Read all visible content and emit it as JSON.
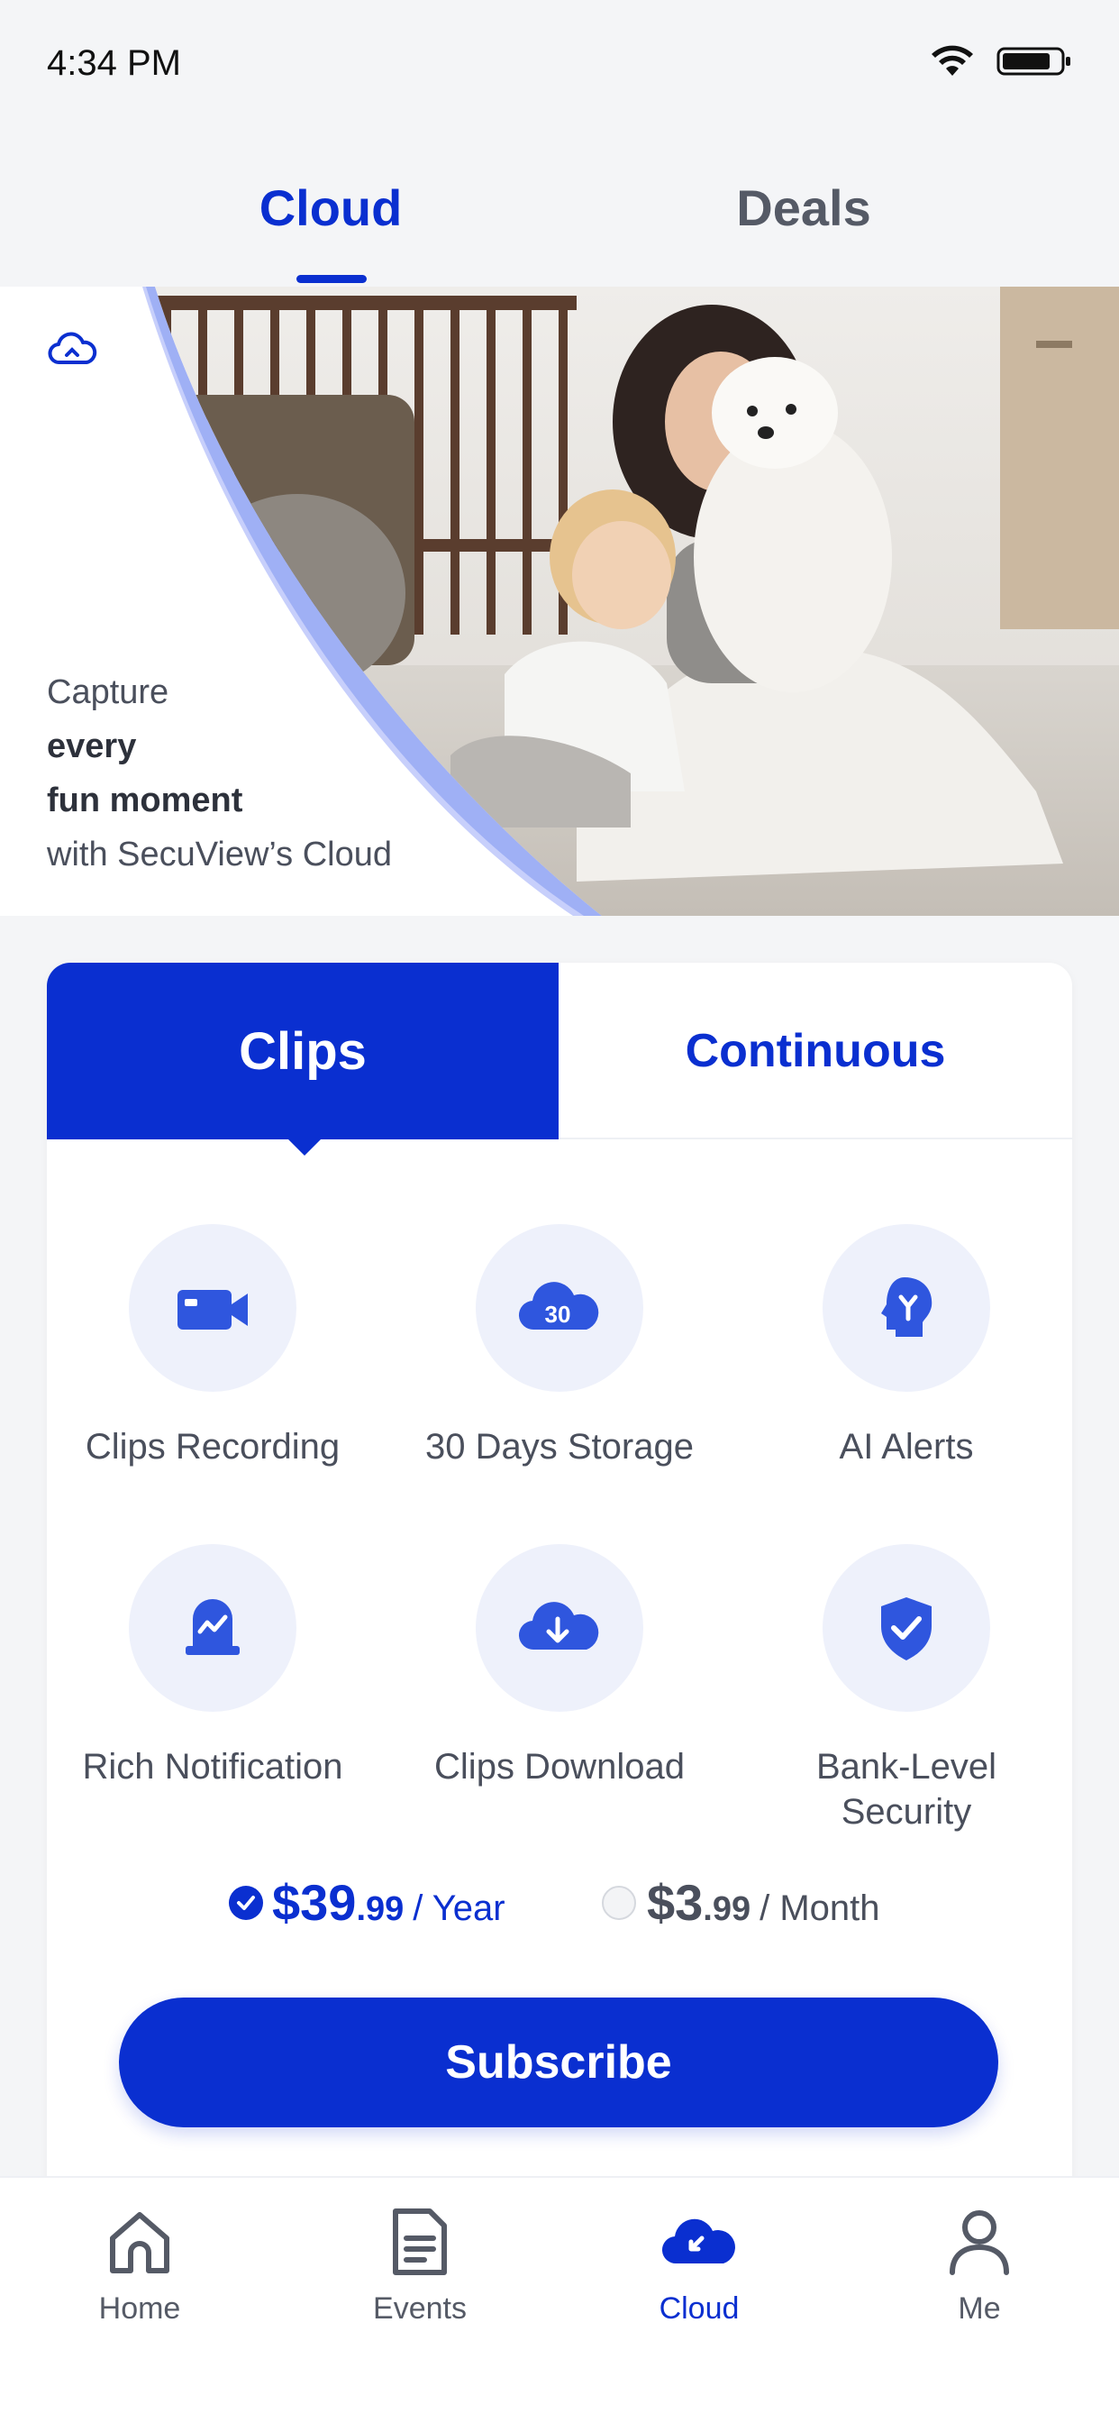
{
  "status_bar": {
    "time": "4:34 PM",
    "icons": [
      "wifi-icon",
      "battery-icon"
    ]
  },
  "top_tabs": {
    "cloud": "Cloud",
    "deals": "Deals",
    "active": "Cloud"
  },
  "banner": {
    "icon": "cloud-icon",
    "line1": "Capture",
    "line2": "every",
    "line3": "fun moment",
    "line4": "with SecuView’s Cloud"
  },
  "plan_tabs": {
    "clips": "Clips",
    "continuous": "Continuous",
    "active": "Clips"
  },
  "features": [
    {
      "label": "Clips Recording",
      "icon": "video-camera-icon"
    },
    {
      "label": "30 Days Storage",
      "icon": "cloud-30-icon",
      "badge": "30"
    },
    {
      "label": "AI Alerts",
      "icon": "ai-head-icon"
    },
    {
      "label": "Rich Notification",
      "icon": "notification-icon"
    },
    {
      "label": "Clips Download",
      "icon": "cloud-download-icon"
    },
    {
      "label": "Bank-Level Security",
      "icon": "shield-check-icon"
    }
  ],
  "pricing": {
    "year": {
      "dollars": "$39",
      "cents": ".99",
      "unit": "/ Year",
      "selected": true
    },
    "month": {
      "dollars": "$3",
      "cents": ".99",
      "unit": "/ Month",
      "selected": false
    }
  },
  "subscribe_label": "Subscribe",
  "bottom_nav": [
    {
      "label": "Home",
      "icon": "home-icon"
    },
    {
      "label": "Events",
      "icon": "document-icon"
    },
    {
      "label": "Cloud",
      "icon": "cloud-icon",
      "active": true
    },
    {
      "label": "Me",
      "icon": "user-icon"
    }
  ],
  "colors": {
    "accent": "#0a2fd0",
    "icon_bg": "#eef1fb",
    "text_gray": "#4a4f5c",
    "page_bg": "#f4f5f7"
  }
}
